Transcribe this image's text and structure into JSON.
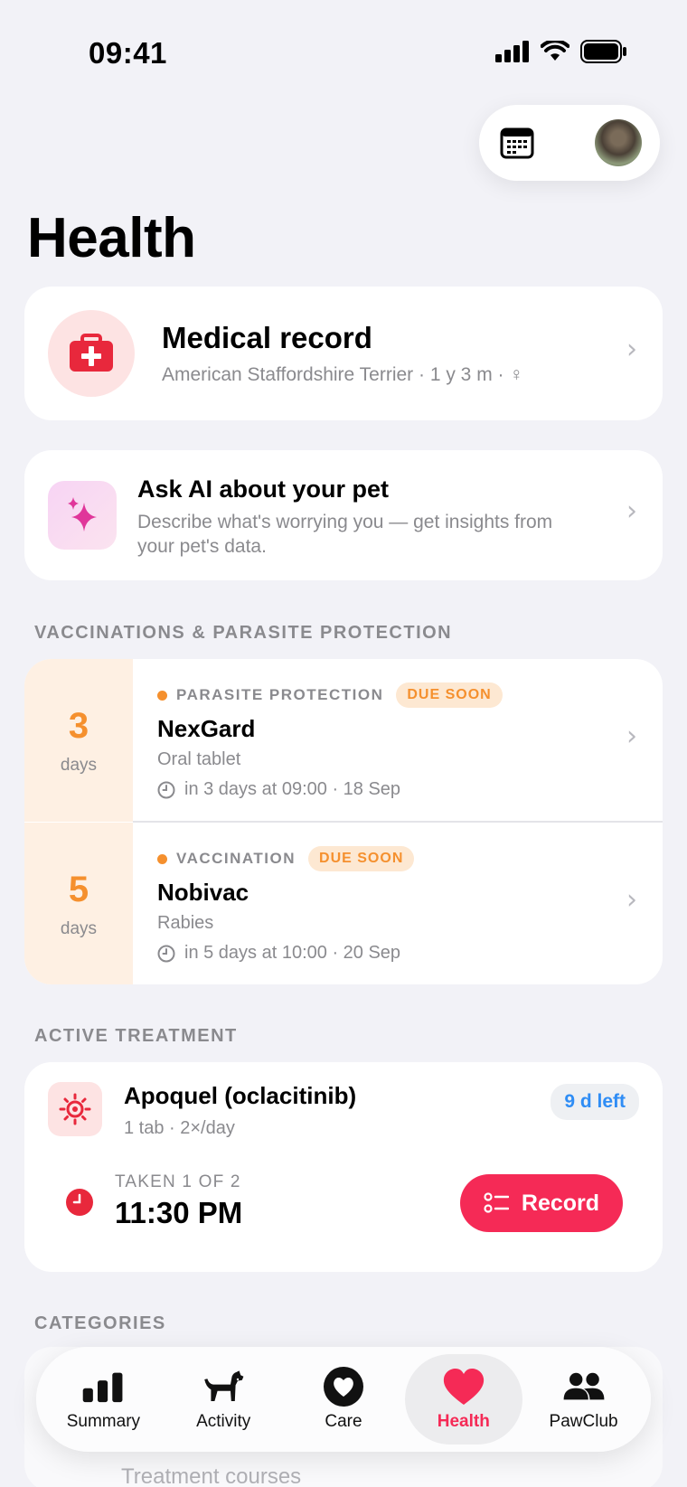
{
  "status_bar": {
    "time": "09:41"
  },
  "page": {
    "title": "Health"
  },
  "medical_record": {
    "title": "Medical record",
    "subtitle": "American Staffordshire Terrier · 1 y 3 m · ♀"
  },
  "ai": {
    "title": "Ask AI about your pet",
    "description": "Describe what's worrying you — get insights from your pet's data."
  },
  "vaccinations": {
    "section_label": "VACCINATIONS & PARASITE PROTECTION",
    "items": [
      {
        "days": "3",
        "days_unit": "days",
        "category": "PARASITE PROTECTION",
        "badge": "DUE SOON",
        "name": "NexGard",
        "type": "Oral tablet",
        "when": "in 3 days at 09:00 · 18 Sep"
      },
      {
        "days": "5",
        "days_unit": "days",
        "category": "VACCINATION",
        "badge": "DUE SOON",
        "name": "Nobivac",
        "type": "Rabies",
        "when": "in 5 days at 10:00 · 20 Sep"
      }
    ]
  },
  "treatment": {
    "section_label": "ACTIVE TREATMENT",
    "name": "Apoquel (oclacitinib)",
    "dose": "1 tab · 2×/day",
    "remaining": "9 d left",
    "taken_label": "TAKEN 1 OF 2",
    "taken_time": "11:30 PM",
    "record_label": "Record"
  },
  "categories": {
    "section_label": "CATEGORIES",
    "peek_item": "Treatment courses"
  },
  "tabbar": {
    "items": [
      {
        "label": "Summary",
        "icon": "bar-chart-icon"
      },
      {
        "label": "Activity",
        "icon": "dog-icon"
      },
      {
        "label": "Care",
        "icon": "heart-circle-icon"
      },
      {
        "label": "Health",
        "icon": "heart-icon",
        "active": true
      },
      {
        "label": "PawClub",
        "icon": "people-icon"
      }
    ]
  },
  "colors": {
    "accent": "#f52a56",
    "warning": "#f5902e",
    "info": "#2f8df5",
    "background": "#f2f2f7"
  }
}
